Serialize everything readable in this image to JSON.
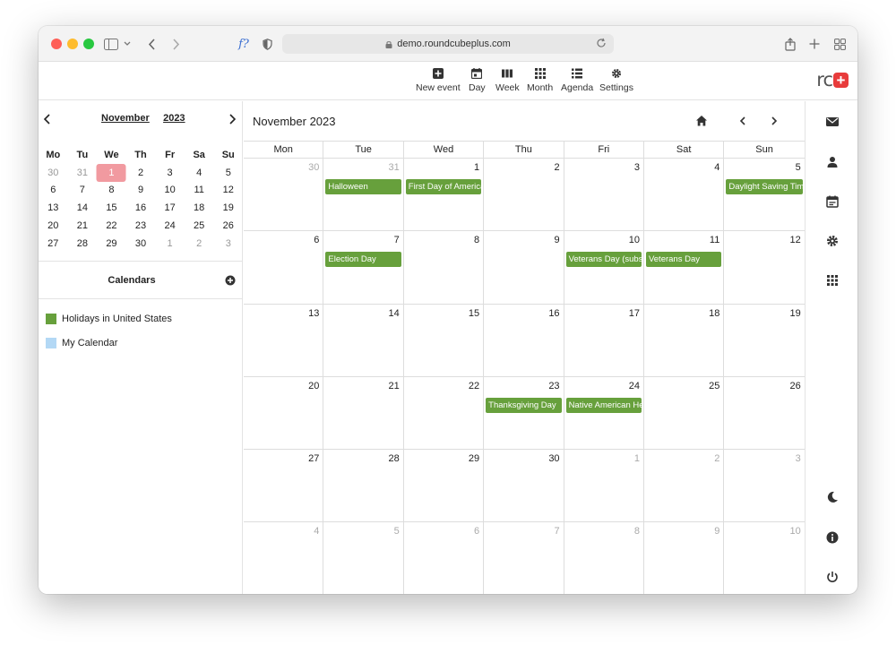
{
  "browser": {
    "url": "demo.roundcubeplus.com",
    "ext_label": "f?"
  },
  "toolbar": {
    "new_event": "New event",
    "day": "Day",
    "week": "Week",
    "month": "Month",
    "agenda": "Agenda",
    "settings": "Settings"
  },
  "logo": {
    "text": "rc",
    "plus": "+"
  },
  "mini_calendar": {
    "month": "November",
    "year": "2023",
    "weekdays": [
      "Mo",
      "Tu",
      "We",
      "Th",
      "Fr",
      "Sa",
      "Su"
    ],
    "weeks": [
      [
        "30",
        "31",
        "1",
        "2",
        "3",
        "4",
        "5"
      ],
      [
        "6",
        "7",
        "8",
        "9",
        "10",
        "11",
        "12"
      ],
      [
        "13",
        "14",
        "15",
        "16",
        "17",
        "18",
        "19"
      ],
      [
        "20",
        "21",
        "22",
        "23",
        "24",
        "25",
        "26"
      ],
      [
        "27",
        "28",
        "29",
        "30",
        "1",
        "2",
        "3"
      ]
    ]
  },
  "calendars": {
    "title": "Calendars",
    "items": [
      {
        "label": "Holidays in United States",
        "color": "#67a03c"
      },
      {
        "label": "My Calendar",
        "color": "#b3d8f5"
      }
    ]
  },
  "main": {
    "title": "November 2023",
    "weekdays": [
      "Mon",
      "Tue",
      "Wed",
      "Thu",
      "Fri",
      "Sat",
      "Sun"
    ],
    "weeks": [
      [
        "30",
        "31",
        "1",
        "2",
        "3",
        "4",
        "5"
      ],
      [
        "6",
        "7",
        "8",
        "9",
        "10",
        "11",
        "12"
      ],
      [
        "13",
        "14",
        "15",
        "16",
        "17",
        "18",
        "19"
      ],
      [
        "20",
        "21",
        "22",
        "23",
        "24",
        "25",
        "26"
      ],
      [
        "27",
        "28",
        "29",
        "30",
        "1",
        "2",
        "3"
      ],
      [
        "4",
        "5",
        "6",
        "7",
        "8",
        "9",
        "10"
      ]
    ],
    "events": {
      "halloween": "Halloween",
      "first_day_america": "First Day of America",
      "daylight_saving": "Daylight Saving Time",
      "election_day": "Election Day",
      "veterans_subst": "Veterans Day (subst",
      "veterans_day": "Veterans Day",
      "thanksgiving": "Thanksgiving Day",
      "native_american": "Native American Her"
    },
    "event_color": "#67a03c"
  },
  "accent": {
    "today": "#f19aa0",
    "logo_red": "#e83b3b"
  }
}
